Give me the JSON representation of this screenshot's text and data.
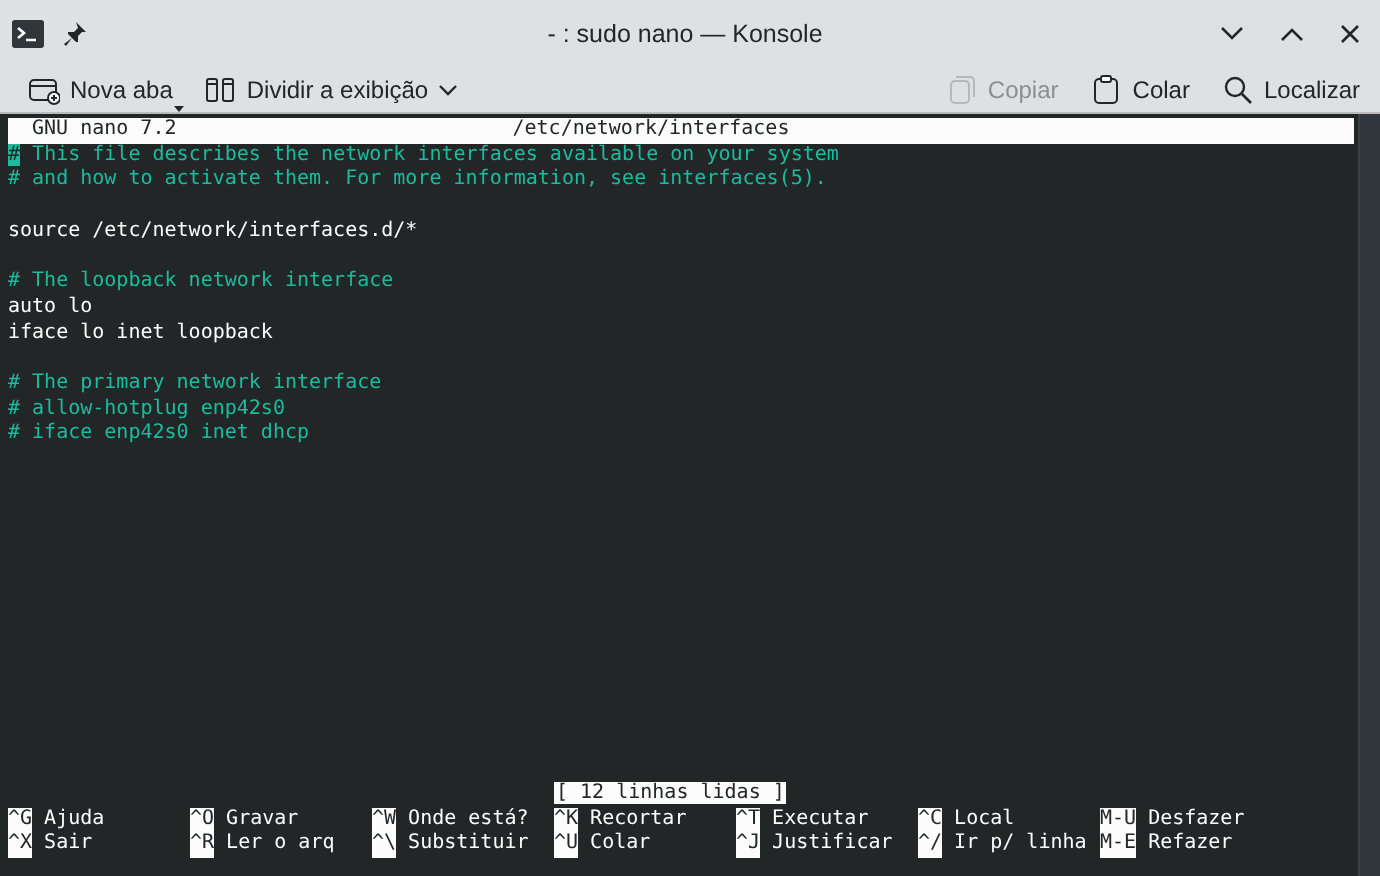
{
  "window": {
    "title": "- : sudo nano — Konsole"
  },
  "toolbar": [
    {
      "kind": "new-tab",
      "label": "Nova aba",
      "disabled": false
    },
    {
      "kind": "split",
      "label": "Dividir a exibição",
      "disabled": false
    },
    {
      "kind": "copy",
      "label": "Copiar",
      "disabled": true
    },
    {
      "kind": "paste",
      "label": "Colar",
      "disabled": false
    },
    {
      "kind": "find",
      "label": "Localizar",
      "disabled": false
    }
  ],
  "nano": {
    "version": "GNU nano 7.2",
    "filename": "/etc/network/interfaces",
    "lines": [
      {
        "kind": "comment",
        "text": "# This file describes the network interfaces available on your system",
        "cursor": true
      },
      {
        "kind": "comment",
        "text": "# and how to activate them. For more information, see interfaces(5).",
        "cursor": false
      },
      {
        "kind": "blank",
        "cursor": false
      },
      {
        "kind": "code",
        "text": "source /etc/network/interfaces.d/*",
        "cursor": false
      },
      {
        "kind": "blank",
        "cursor": false
      },
      {
        "kind": "comment",
        "text": "# The loopback network interface",
        "cursor": false
      },
      {
        "kind": "code",
        "text": "auto lo",
        "cursor": false
      },
      {
        "kind": "code",
        "text": "iface lo inet loopback",
        "cursor": false
      },
      {
        "kind": "blank",
        "cursor": false
      },
      {
        "kind": "comment",
        "text": "# The primary network interface",
        "cursor": false
      },
      {
        "kind": "comment",
        "text": "# allow-hotplug enp42s0",
        "cursor": false
      },
      {
        "kind": "comment",
        "text": "# iface enp42s0 inet dhcp",
        "cursor": false
      }
    ],
    "status": "[ 12 linhas lidas ]",
    "shortcuts": [
      [
        {
          "key": "^G",
          "label": "Ajuda"
        },
        {
          "key": "^O",
          "label": "Gravar"
        },
        {
          "key": "^W",
          "label": "Onde está?"
        },
        {
          "key": "^K",
          "label": "Recortar"
        },
        {
          "key": "^T",
          "label": "Executar"
        },
        {
          "key": "^C",
          "label": "Local"
        },
        {
          "key": "M-U",
          "label": "Desfazer"
        }
      ],
      [
        {
          "key": "^X",
          "label": "Sair"
        },
        {
          "key": "^R",
          "label": "Ler o arq"
        },
        {
          "key": "^\\",
          "label": "Substituir"
        },
        {
          "key": "^U",
          "label": "Colar"
        },
        {
          "key": "^J",
          "label": "Justificar"
        },
        {
          "key": "^/",
          "label": "Ir p/ linha"
        },
        {
          "key": "M-E",
          "label": "Refazer"
        }
      ]
    ]
  }
}
